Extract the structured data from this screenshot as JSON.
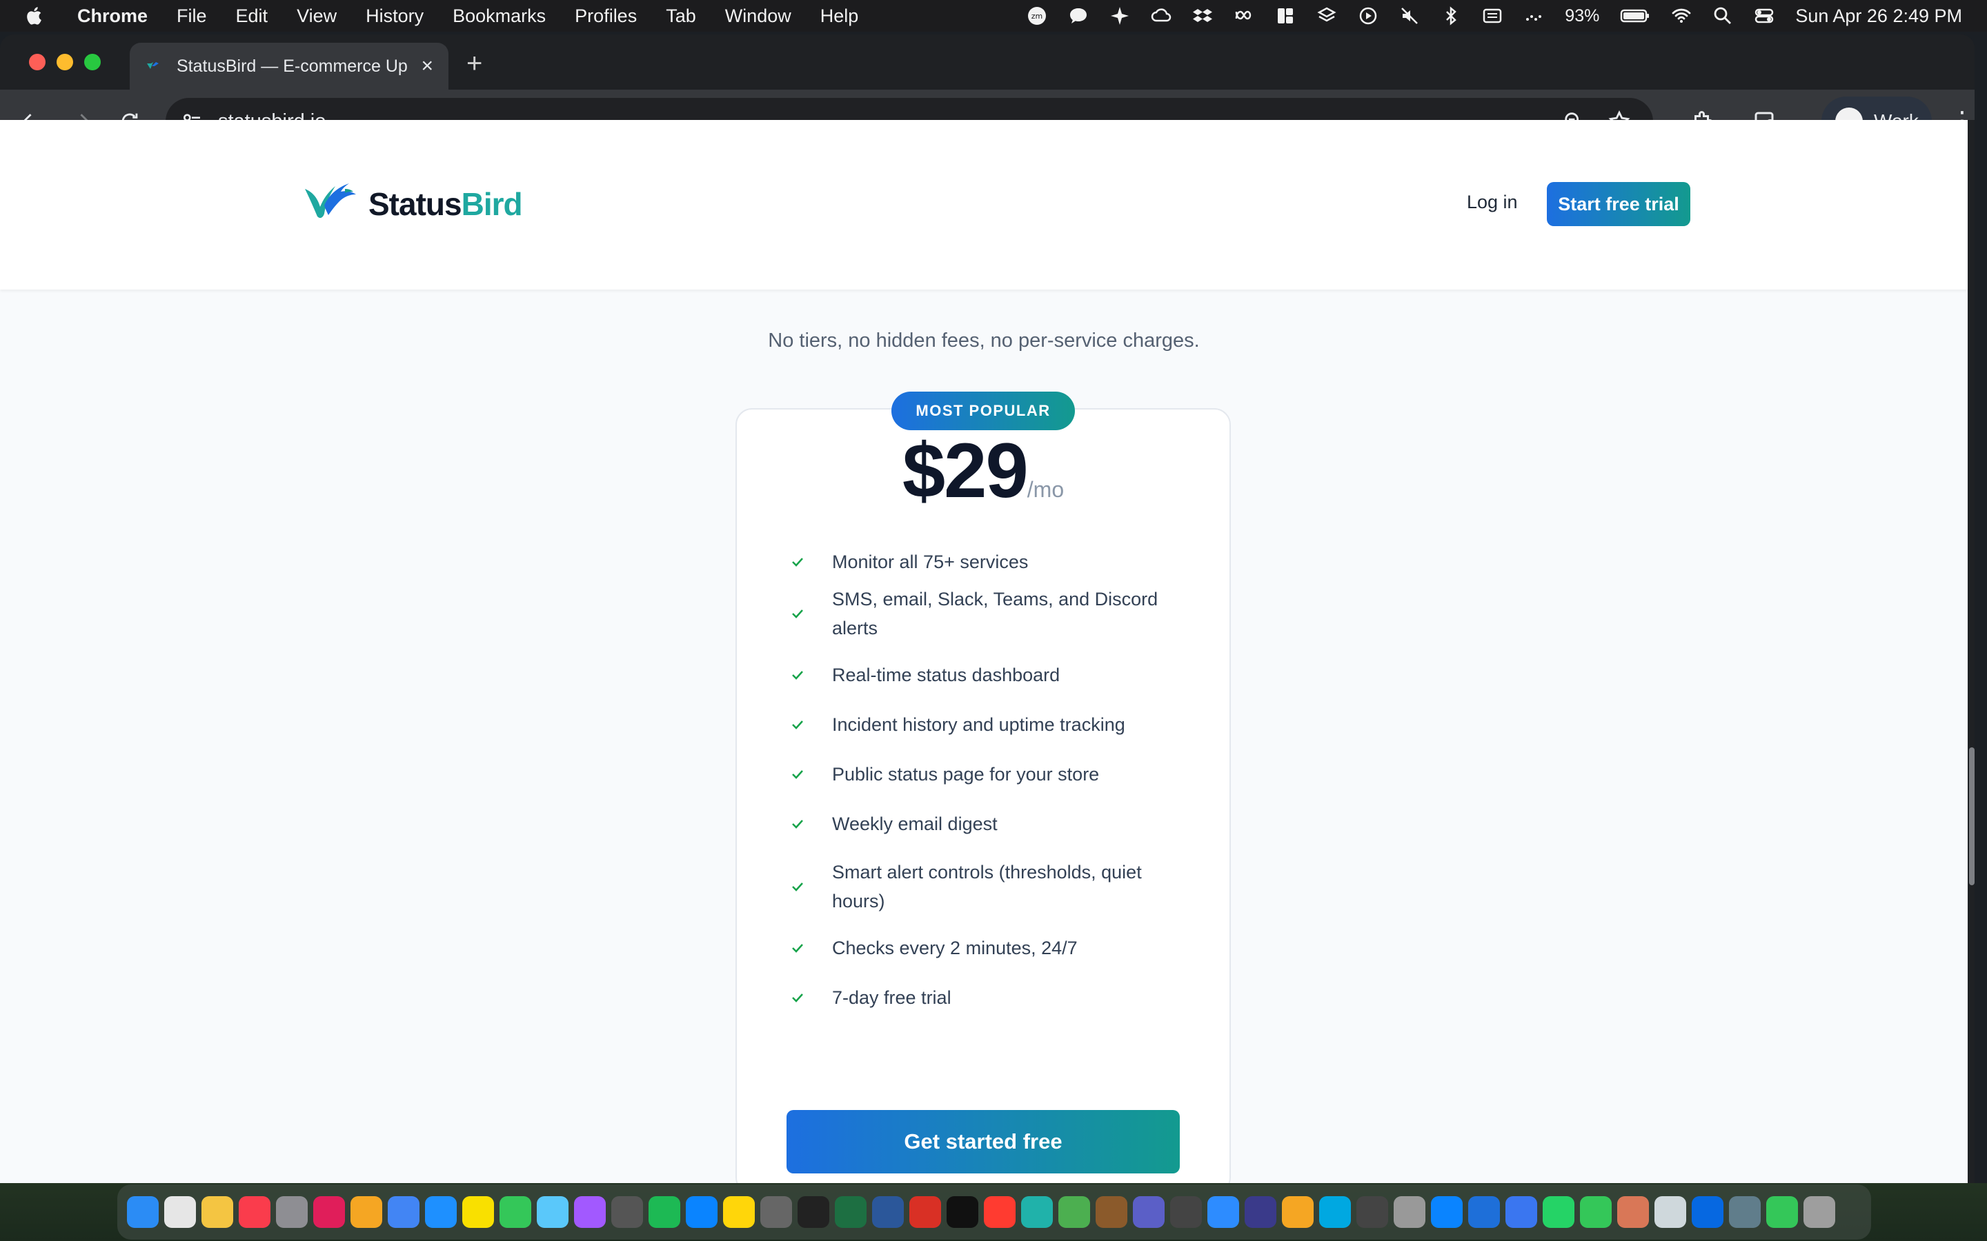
{
  "menubar": {
    "app_name": "Chrome",
    "items": [
      "File",
      "Edit",
      "View",
      "History",
      "Bookmarks",
      "Profiles",
      "Tab",
      "Window",
      "Help"
    ],
    "battery": "93%",
    "clock": "Sun Apr 26  2:49 PM"
  },
  "browser": {
    "tab_title": "StatusBird — E-commerce Up",
    "url": "statusbird.io",
    "profile_label": "Work"
  },
  "site": {
    "brand_part1": "Status",
    "brand_part2": "Bird",
    "login_label": "Log in",
    "trial_label": "Start free trial"
  },
  "pricing": {
    "subtitle": "No tiers, no hidden fees, no per-service charges.",
    "badge": "MOST POPULAR",
    "amount": "$29",
    "period": "/mo",
    "features": [
      "Monitor all 75+ services",
      "SMS, email, Slack, Teams, and Discord alerts",
      "Real-time status dashboard",
      "Incident history and uptime tracking",
      "Public status page for your store",
      "Weekly email digest",
      "Smart alert controls (thresholds, quiet hours)",
      "Checks every 2 minutes, 24/7",
      "7-day free trial"
    ],
    "cta": "Get started free"
  },
  "colors": {
    "brand_blue": "#1d6fe0",
    "brand_teal": "#139a8f",
    "check_green": "#16a34a"
  },
  "dock": {
    "apps": [
      "finder-icon",
      "launchpad-icon",
      "notes-icon",
      "music-icon",
      "settings-icon",
      "slack-icon",
      "photos-icon",
      "chrome-icon",
      "safari-icon",
      "kakaotalk-icon",
      "facetime-icon",
      "quicktime-icon",
      "podcasts-icon",
      "davinci-icon",
      "spotify-icon",
      "appstore-icon",
      "notes2-icon",
      "calculator-icon",
      "terminal-icon",
      "excel-icon",
      "word-icon",
      "acrobat-icon",
      "appletv-icon",
      "power-icon",
      "perplexity-icon",
      "mongodb-icon",
      "leaf-icon",
      "teams-icon",
      "help-icon",
      "zoom-icon",
      "arc-icon",
      "pages-icon",
      "primevideo-icon",
      "help2-icon",
      "mirror-icon",
      "files-icon",
      "xcode-icon",
      "signal-icon",
      "whatsapp-icon",
      "messages-icon",
      "claude-icon",
      "preview-icon",
      "meta-icon",
      "display-icon",
      "numbers-icon",
      "trash-icon"
    ]
  }
}
